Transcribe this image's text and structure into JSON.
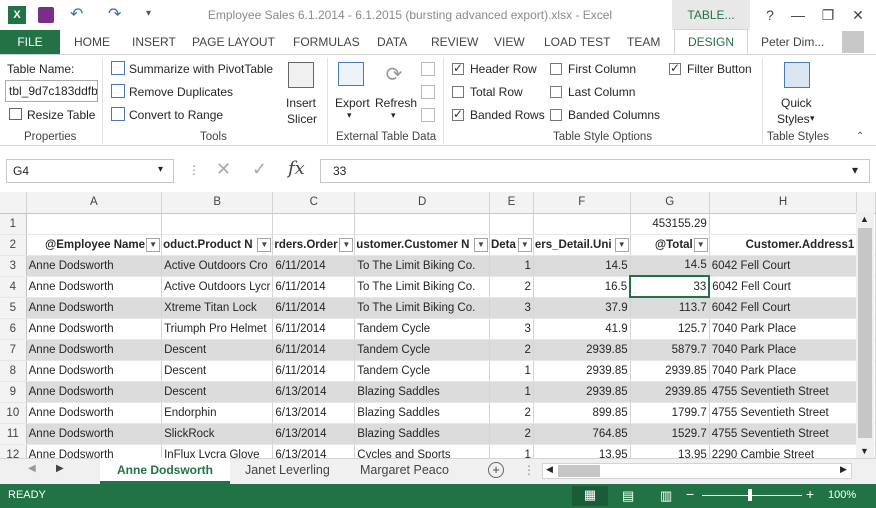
{
  "app": {
    "title": "Employee Sales  6.1.2014 - 6.1.2015 (bursting advanced export).xlsx - Excel",
    "context_tab": "TABLE...",
    "user": "Peter Dim..."
  },
  "tabs": [
    "FILE",
    "HOME",
    "INSERT",
    "PAGE LAYOUT",
    "FORMULAS",
    "DATA",
    "REVIEW",
    "VIEW",
    "LOAD TEST",
    "TEAM",
    "DESIGN"
  ],
  "ribbon": {
    "properties": {
      "table_name_label": "Table Name:",
      "table_name_value": "tbl_9d7c183ddfb",
      "resize": "Resize Table",
      "group": "Properties"
    },
    "tools": {
      "pivot": "Summarize with PivotTable",
      "dupes": "Remove Duplicates",
      "range": "Convert to Range",
      "insert": "Insert",
      "slicer": "Slicer",
      "group": "Tools"
    },
    "external": {
      "export": "Export",
      "refresh": "Refresh",
      "group": "External Table Data"
    },
    "style_options": {
      "header_row": "Header Row",
      "total_row": "Total Row",
      "banded_rows": "Banded Rows",
      "first_column": "First Column",
      "last_column": "Last Column",
      "banded_columns": "Banded Columns",
      "filter_button": "Filter Button",
      "group": "Table Style Options"
    },
    "styles": {
      "quick": "Quick",
      "styles": "Styles",
      "group": "Table Styles"
    }
  },
  "formula_bar": {
    "name_box": "G4",
    "fx": "fx",
    "value": "33"
  },
  "grid": {
    "columns": [
      "A",
      "B",
      "C",
      "D",
      "E",
      "F",
      "G",
      "H"
    ],
    "row1_g": "453155.29",
    "headers": [
      "@Employee Name",
      "oduct.Product N",
      "rders.Order",
      "ustomer.Customer N",
      "Deta",
      "ers_Detail.Uni",
      "@Total",
      "Customer.Address1"
    ],
    "rows": [
      {
        "n": "3",
        "a": "Anne Dodsworth",
        "b": "Active Outdoors Cro",
        "c": "6/11/2014",
        "d": "To The Limit Biking Co.",
        "e": "1",
        "f": "14.5",
        "g": "14.5",
        "h": "6042 Fell Court"
      },
      {
        "n": "4",
        "a": "Anne Dodsworth",
        "b": "Active Outdoors Lycr",
        "c": "6/11/2014",
        "d": "To The Limit Biking Co.",
        "e": "2",
        "f": "16.5",
        "g": "33",
        "h": "6042 Fell Court"
      },
      {
        "n": "5",
        "a": "Anne Dodsworth",
        "b": "Xtreme Titan Lock",
        "c": "6/11/2014",
        "d": "To The Limit Biking Co.",
        "e": "3",
        "f": "37.9",
        "g": "113.7",
        "h": "6042 Fell Court"
      },
      {
        "n": "6",
        "a": "Anne Dodsworth",
        "b": "Triumph Pro Helmet",
        "c": "6/11/2014",
        "d": "Tandem Cycle",
        "e": "3",
        "f": "41.9",
        "g": "125.7",
        "h": "7040 Park Place"
      },
      {
        "n": "7",
        "a": "Anne Dodsworth",
        "b": "Descent",
        "c": "6/11/2014",
        "d": "Tandem Cycle",
        "e": "2",
        "f": "2939.85",
        "g": "5879.7",
        "h": "7040 Park Place"
      },
      {
        "n": "8",
        "a": "Anne Dodsworth",
        "b": "Descent",
        "c": "6/11/2014",
        "d": "Tandem Cycle",
        "e": "1",
        "f": "2939.85",
        "g": "2939.85",
        "h": "7040 Park Place"
      },
      {
        "n": "9",
        "a": "Anne Dodsworth",
        "b": "Descent",
        "c": "6/13/2014",
        "d": "Blazing Saddles",
        "e": "1",
        "f": "2939.85",
        "g": "2939.85",
        "h": "4755 Seventieth Street"
      },
      {
        "n": "10",
        "a": "Anne Dodsworth",
        "b": "Endorphin",
        "c": "6/13/2014",
        "d": "Blazing Saddles",
        "e": "2",
        "f": "899.85",
        "g": "1799.7",
        "h": "4755 Seventieth Street"
      },
      {
        "n": "11",
        "a": "Anne Dodsworth",
        "b": "SlickRock",
        "c": "6/13/2014",
        "d": "Blazing Saddles",
        "e": "2",
        "f": "764.85",
        "g": "1529.7",
        "h": "4755 Seventieth Street"
      },
      {
        "n": "12",
        "a": "Anne Dodsworth",
        "b": "InFlux Lycra Glove",
        "c": "6/13/2014",
        "d": "Cycles and Sports",
        "e": "1",
        "f": "13.95",
        "g": "13.95",
        "h": "2290 Cambie Street"
      }
    ]
  },
  "sheets": [
    "Anne Dodsworth",
    "Janet Leverling",
    "Margaret Peaco"
  ],
  "status": {
    "ready": "READY",
    "zoom": "100%"
  }
}
